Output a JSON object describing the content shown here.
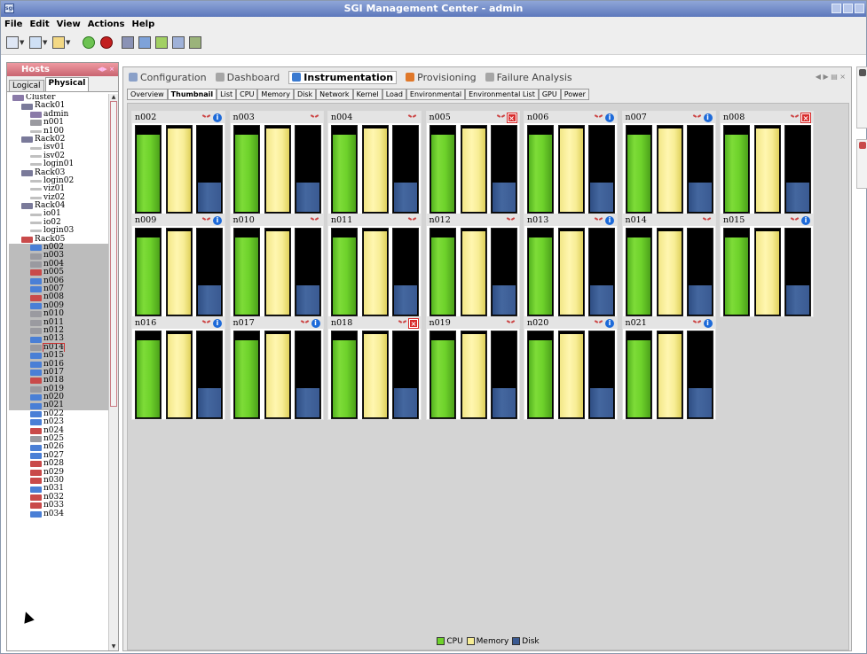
{
  "window": {
    "title": "SGI Management Center - admin"
  },
  "menu": [
    "File",
    "Edit",
    "View",
    "Actions",
    "Help"
  ],
  "hosts_panel": {
    "title": "Hosts",
    "tabs": [
      "Logical",
      "Physical"
    ],
    "active_tab": "Physical",
    "tree": [
      {
        "label": "Cluster",
        "indent": 0,
        "icon": "cluster"
      },
      {
        "label": "Rack01",
        "indent": 1,
        "icon": "rack"
      },
      {
        "label": "admin",
        "indent": 2,
        "icon": "cluster"
      },
      {
        "label": "n001",
        "indent": 2,
        "icon": "node"
      },
      {
        "label": "n100",
        "indent": 2,
        "icon": "grey"
      },
      {
        "label": "Rack02",
        "indent": 1,
        "icon": "rack"
      },
      {
        "label": "isv01",
        "indent": 2,
        "icon": "grey"
      },
      {
        "label": "isv02",
        "indent": 2,
        "icon": "grey"
      },
      {
        "label": "login01",
        "indent": 2,
        "icon": "grey"
      },
      {
        "label": "Rack03",
        "indent": 1,
        "icon": "rack"
      },
      {
        "label": "login02",
        "indent": 2,
        "icon": "grey"
      },
      {
        "label": "viz01",
        "indent": 2,
        "icon": "grey"
      },
      {
        "label": "viz02",
        "indent": 2,
        "icon": "grey"
      },
      {
        "label": "Rack04",
        "indent": 1,
        "icon": "rack"
      },
      {
        "label": "io01",
        "indent": 2,
        "icon": "grey"
      },
      {
        "label": "io02",
        "indent": 2,
        "icon": "grey"
      },
      {
        "label": "login03",
        "indent": 2,
        "icon": "grey"
      },
      {
        "label": "Rack05",
        "indent": 1,
        "icon": "red"
      },
      {
        "label": "n002",
        "indent": 2,
        "icon": "blue",
        "sel": true
      },
      {
        "label": "n003",
        "indent": 2,
        "icon": "node",
        "sel": true
      },
      {
        "label": "n004",
        "indent": 2,
        "icon": "node",
        "sel": true
      },
      {
        "label": "n005",
        "indent": 2,
        "icon": "red",
        "sel": true
      },
      {
        "label": "n006",
        "indent": 2,
        "icon": "blue",
        "sel": true
      },
      {
        "label": "n007",
        "indent": 2,
        "icon": "blue",
        "sel": true
      },
      {
        "label": "n008",
        "indent": 2,
        "icon": "red",
        "sel": true
      },
      {
        "label": "n009",
        "indent": 2,
        "icon": "blue",
        "sel": true
      },
      {
        "label": "n010",
        "indent": 2,
        "icon": "node",
        "sel": true
      },
      {
        "label": "n011",
        "indent": 2,
        "icon": "node",
        "sel": true
      },
      {
        "label": "n012",
        "indent": 2,
        "icon": "node",
        "sel": true
      },
      {
        "label": "n013",
        "indent": 2,
        "icon": "blue",
        "sel": true
      },
      {
        "label": "n014",
        "indent": 2,
        "icon": "node",
        "sel": true,
        "hl": true
      },
      {
        "label": "n015",
        "indent": 2,
        "icon": "blue",
        "sel": true
      },
      {
        "label": "n016",
        "indent": 2,
        "icon": "blue",
        "sel": true
      },
      {
        "label": "n017",
        "indent": 2,
        "icon": "blue",
        "sel": true
      },
      {
        "label": "n018",
        "indent": 2,
        "icon": "red",
        "sel": true
      },
      {
        "label": "n019",
        "indent": 2,
        "icon": "node",
        "sel": true
      },
      {
        "label": "n020",
        "indent": 2,
        "icon": "blue",
        "sel": true
      },
      {
        "label": "n021",
        "indent": 2,
        "icon": "blue",
        "sel": true
      },
      {
        "label": "n022",
        "indent": 2,
        "icon": "blue"
      },
      {
        "label": "n023",
        "indent": 2,
        "icon": "blue"
      },
      {
        "label": "n024",
        "indent": 2,
        "icon": "red"
      },
      {
        "label": "n025",
        "indent": 2,
        "icon": "node"
      },
      {
        "label": "n026",
        "indent": 2,
        "icon": "blue"
      },
      {
        "label": "n027",
        "indent": 2,
        "icon": "blue"
      },
      {
        "label": "n028",
        "indent": 2,
        "icon": "red"
      },
      {
        "label": "n029",
        "indent": 2,
        "icon": "red"
      },
      {
        "label": "n030",
        "indent": 2,
        "icon": "red"
      },
      {
        "label": "n031",
        "indent": 2,
        "icon": "blue"
      },
      {
        "label": "n032",
        "indent": 2,
        "icon": "red"
      },
      {
        "label": "n033",
        "indent": 2,
        "icon": "red"
      },
      {
        "label": "n034",
        "indent": 2,
        "icon": "blue"
      }
    ]
  },
  "perspectives": [
    {
      "label": "Configuration",
      "icon": "#8aa0c8"
    },
    {
      "label": "Dashboard",
      "icon": "#a6a6a6"
    },
    {
      "label": "Instrumentation",
      "icon": "#3a7ad0",
      "active": true
    },
    {
      "label": "Provisioning",
      "icon": "#e0782a"
    },
    {
      "label": "Failure Analysis",
      "icon": "#a6a6a6"
    }
  ],
  "subtabs": [
    "Overview",
    "Thumbnail",
    "List",
    "CPU",
    "Memory",
    "Disk",
    "Network",
    "Kernel",
    "Load",
    "Environmental",
    "Environmental List",
    "GPU",
    "Power"
  ],
  "active_subtab": "Thumbnail",
  "legend": {
    "cpu": "CPU",
    "memory": "Memory",
    "disk": "Disk"
  },
  "colors": {
    "cpu": "#6ed22b",
    "memory": "#f7ed95",
    "disk": "#3a5a92",
    "error": "#d82b2b",
    "info": "#1d6ad9"
  },
  "nodes": [
    {
      "name": "n002",
      "status": "info",
      "cpu": 0.89,
      "memory": 0.96,
      "disk": 0.34
    },
    {
      "name": "n003",
      "status": "none",
      "cpu": 0.89,
      "memory": 0.96,
      "disk": 0.34
    },
    {
      "name": "n004",
      "status": "none",
      "cpu": 0.89,
      "memory": 0.96,
      "disk": 0.34
    },
    {
      "name": "n005",
      "status": "error",
      "cpu": 0.89,
      "memory": 0.96,
      "disk": 0.34
    },
    {
      "name": "n006",
      "status": "info",
      "cpu": 0.89,
      "memory": 0.96,
      "disk": 0.34
    },
    {
      "name": "n007",
      "status": "info",
      "cpu": 0.89,
      "memory": 0.96,
      "disk": 0.34
    },
    {
      "name": "n008",
      "status": "error",
      "cpu": 0.89,
      "memory": 0.96,
      "disk": 0.34
    },
    {
      "name": "n009",
      "status": "info",
      "cpu": 0.89,
      "memory": 0.96,
      "disk": 0.34
    },
    {
      "name": "n010",
      "status": "none",
      "cpu": 0.89,
      "memory": 0.96,
      "disk": 0.34
    },
    {
      "name": "n011",
      "status": "none",
      "cpu": 0.89,
      "memory": 0.96,
      "disk": 0.34
    },
    {
      "name": "n012",
      "status": "none",
      "cpu": 0.89,
      "memory": 0.96,
      "disk": 0.34
    },
    {
      "name": "n013",
      "status": "info",
      "cpu": 0.89,
      "memory": 0.96,
      "disk": 0.34
    },
    {
      "name": "n014",
      "status": "none",
      "cpu": 0.89,
      "memory": 0.96,
      "disk": 0.34
    },
    {
      "name": "n015",
      "status": "info",
      "cpu": 0.89,
      "memory": 0.96,
      "disk": 0.34
    },
    {
      "name": "n016",
      "status": "info",
      "cpu": 0.89,
      "memory": 0.96,
      "disk": 0.34
    },
    {
      "name": "n017",
      "status": "info",
      "cpu": 0.89,
      "memory": 0.96,
      "disk": 0.34
    },
    {
      "name": "n018",
      "status": "error",
      "cpu": 0.89,
      "memory": 0.96,
      "disk": 0.34
    },
    {
      "name": "n019",
      "status": "none",
      "cpu": 0.89,
      "memory": 0.96,
      "disk": 0.34
    },
    {
      "name": "n020",
      "status": "info",
      "cpu": 0.89,
      "memory": 0.96,
      "disk": 0.34
    },
    {
      "name": "n021",
      "status": "info",
      "cpu": 0.89,
      "memory": 0.96,
      "disk": 0.34
    }
  ]
}
